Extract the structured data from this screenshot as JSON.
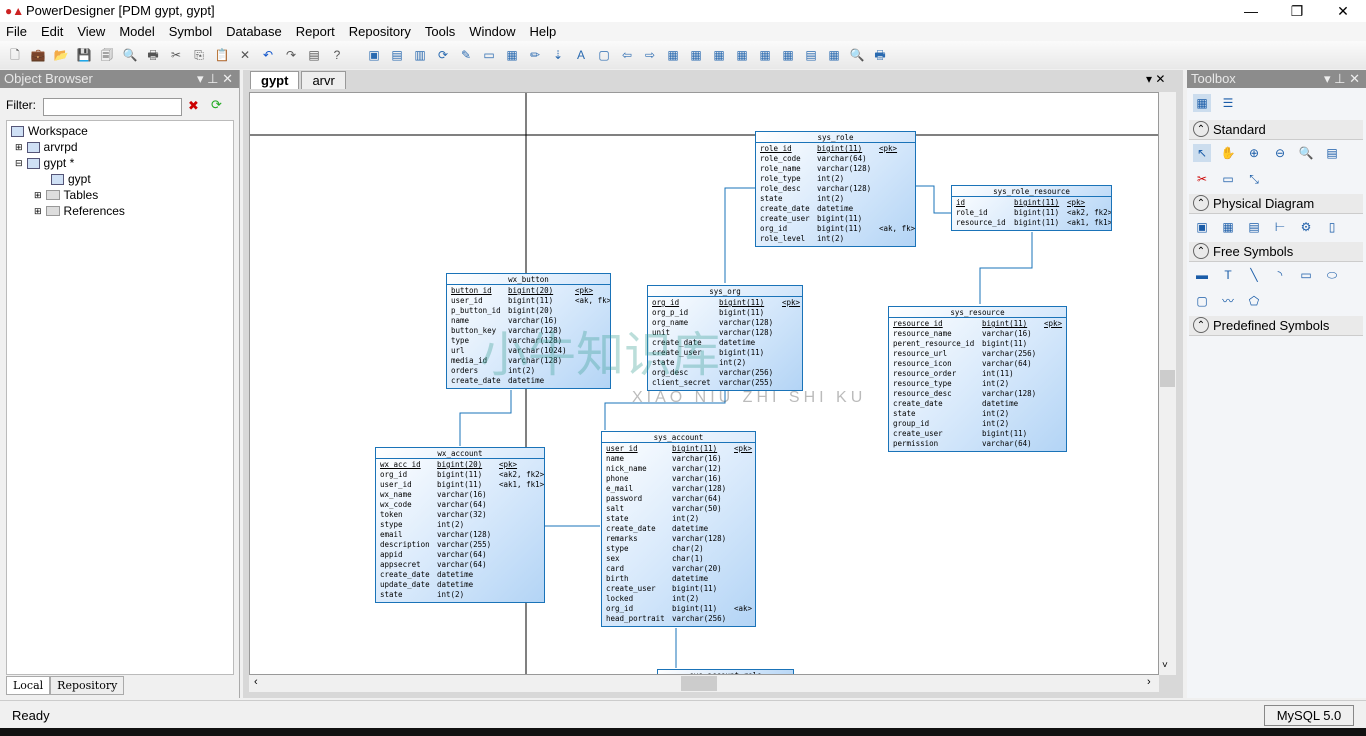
{
  "window": {
    "title": "PowerDesigner [PDM gypt, gypt]",
    "controls": [
      "—",
      "❐",
      "✕"
    ]
  },
  "menu": [
    "File",
    "Edit",
    "View",
    "Model",
    "Symbol",
    "Database",
    "Report",
    "Repository",
    "Tools",
    "Window",
    "Help"
  ],
  "toolbar_icons": [
    "new-icon",
    "new-project-icon",
    "open-icon",
    "save-icon",
    "save-all-icon",
    "print-preview-icon",
    "print-icon",
    "cut-icon",
    "copy-icon",
    "paste-icon",
    "delete-icon",
    "undo-icon",
    "redo-icon",
    "properties-icon",
    "help-icon"
  ],
  "object_browser": {
    "title": "Object Browser",
    "filter_label": "Filter:",
    "filter_value": "",
    "tree": [
      {
        "label": "Workspace",
        "level": 0
      },
      {
        "label": "arvrpd",
        "level": 1
      },
      {
        "label": "gypt *",
        "level": 1
      },
      {
        "label": "gypt",
        "level": 2
      },
      {
        "label": "Tables",
        "level": 2
      },
      {
        "label": "References",
        "level": 2
      }
    ],
    "tabs": [
      "Local",
      "Repository"
    ]
  },
  "editor": {
    "tabs": [
      "gypt",
      "arvr"
    ],
    "active_tab": "gypt"
  },
  "tables": [
    {
      "name": "sys_role",
      "cols": [
        [
          "role_id",
          "bigint(11)",
          "<pk>"
        ],
        [
          "role_code",
          "varchar(64)",
          ""
        ],
        [
          "role_name",
          "varchar(128)",
          ""
        ],
        [
          "role_type",
          "int(2)",
          ""
        ],
        [
          "role_desc",
          "varchar(128)",
          ""
        ],
        [
          "state",
          "int(2)",
          ""
        ],
        [
          "create_date",
          "datetime",
          ""
        ],
        [
          "create_user",
          "bigint(11)",
          ""
        ],
        [
          "org_id",
          "bigint(11)",
          "<ak, fk>"
        ],
        [
          "role_level",
          "int(2)",
          ""
        ]
      ]
    },
    {
      "name": "sys_role_resource",
      "cols": [
        [
          "id",
          "bigint(11)",
          "<pk>"
        ],
        [
          "role_id",
          "bigint(11)",
          "<ak2, fk2>"
        ],
        [
          "resource_id",
          "bigint(11)",
          "<ak1, fk1>"
        ]
      ]
    },
    {
      "name": "wx_button",
      "cols": [
        [
          "button_id",
          "bigint(20)",
          "<pk>"
        ],
        [
          "user_id",
          "bigint(11)",
          "<ak, fk>"
        ],
        [
          "p_button_id",
          "bigint(20)",
          ""
        ],
        [
          "name",
          "varchar(16)",
          ""
        ],
        [
          "button_key",
          "varchar(128)",
          ""
        ],
        [
          "type",
          "varchar(128)",
          ""
        ],
        [
          "url",
          "varchar(1024)",
          ""
        ],
        [
          "media_id",
          "varchar(128)",
          ""
        ],
        [
          "orders",
          "int(2)",
          ""
        ],
        [
          "create_date",
          "datetime",
          ""
        ]
      ]
    },
    {
      "name": "sys_org",
      "cols": [
        [
          "org_id",
          "bigint(11)",
          "<pk>"
        ],
        [
          "org_p_id",
          "bigint(11)",
          ""
        ],
        [
          "org_name",
          "varchar(128)",
          ""
        ],
        [
          "unit",
          "varchar(128)",
          ""
        ],
        [
          "create_date",
          "datetime",
          ""
        ],
        [
          "create_user",
          "bigint(11)",
          ""
        ],
        [
          "state",
          "int(2)",
          ""
        ],
        [
          "org_desc",
          "varchar(256)",
          ""
        ],
        [
          "client_secret",
          "varchar(255)",
          ""
        ]
      ]
    },
    {
      "name": "sys_resource",
      "cols": [
        [
          "resource_id",
          "bigint(11)",
          "<pk>"
        ],
        [
          "resource_name",
          "varchar(16)",
          ""
        ],
        [
          "perent_resource_id",
          "bigint(11)",
          ""
        ],
        [
          "resource_url",
          "varchar(256)",
          ""
        ],
        [
          "resource_icon",
          "varchar(64)",
          ""
        ],
        [
          "resource_order",
          "int(11)",
          ""
        ],
        [
          "resource_type",
          "int(2)",
          ""
        ],
        [
          "resource_desc",
          "varchar(128)",
          ""
        ],
        [
          "create_date",
          "datetime",
          ""
        ],
        [
          "state",
          "int(2)",
          ""
        ],
        [
          "group_id",
          "int(2)",
          ""
        ],
        [
          "create_user",
          "bigint(11)",
          ""
        ],
        [
          "permission",
          "varchar(64)",
          ""
        ]
      ]
    },
    {
      "name": "wx_account",
      "cols": [
        [
          "wx_acc_id",
          "bigint(20)",
          "<pk>"
        ],
        [
          "org_id",
          "bigint(11)",
          "<ak2, fk2>"
        ],
        [
          "user_id",
          "bigint(11)",
          "<ak1, fk1>"
        ],
        [
          "wx_name",
          "varchar(16)",
          ""
        ],
        [
          "wx_code",
          "varchar(64)",
          ""
        ],
        [
          "token",
          "varchar(32)",
          ""
        ],
        [
          "stype",
          "int(2)",
          ""
        ],
        [
          "email",
          "varchar(128)",
          ""
        ],
        [
          "description",
          "varchar(255)",
          ""
        ],
        [
          "appid",
          "varchar(64)",
          ""
        ],
        [
          "appsecret",
          "varchar(64)",
          ""
        ],
        [
          "create_date",
          "datetime",
          ""
        ],
        [
          "update_date",
          "datetime",
          ""
        ],
        [
          "state",
          "int(2)",
          ""
        ]
      ]
    },
    {
      "name": "sys_account",
      "cols": [
        [
          "user_id",
          "bigint(11)",
          "<pk>"
        ],
        [
          "name",
          "varchar(16)",
          ""
        ],
        [
          "nick_name",
          "varchar(12)",
          ""
        ],
        [
          "phone",
          "varchar(16)",
          ""
        ],
        [
          "e_mail",
          "varchar(128)",
          ""
        ],
        [
          "password",
          "varchar(64)",
          ""
        ],
        [
          "salt",
          "varchar(50)",
          ""
        ],
        [
          "state",
          "int(2)",
          ""
        ],
        [
          "create_date",
          "datetime",
          ""
        ],
        [
          "remarks",
          "varchar(128)",
          ""
        ],
        [
          "stype",
          "char(2)",
          ""
        ],
        [
          "sex",
          "char(1)",
          ""
        ],
        [
          "card",
          "varchar(20)",
          ""
        ],
        [
          "birth",
          "datetime",
          ""
        ],
        [
          "create_user",
          "bigint(11)",
          ""
        ],
        [
          "locked",
          "int(2)",
          ""
        ],
        [
          "org_id",
          "bigint(11)",
          "<ak>"
        ],
        [
          "head_portrait",
          "varchar(256)",
          ""
        ]
      ]
    },
    {
      "name": "sys_account_role",
      "cols": []
    }
  ],
  "watermark": {
    "cn": "小牛知识库",
    "en": "XIAO NIU ZHI SHI KU"
  },
  "toolbox": {
    "title": "Toolbox",
    "sections": [
      "Standard",
      "Physical Diagram",
      "Free Symbols",
      "Predefined Symbols"
    ]
  },
  "status": {
    "text": "Ready",
    "dbms": "MySQL 5.0"
  },
  "colors": {
    "table_border": "#1a73b8",
    "table_fill": "#b3d4f5"
  }
}
